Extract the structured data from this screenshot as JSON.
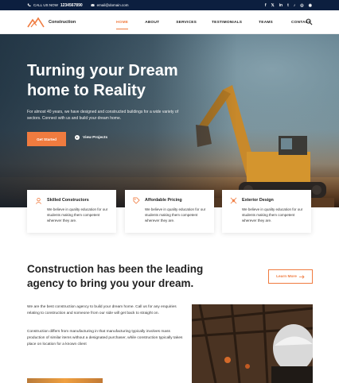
{
  "topbar": {
    "phone_label": "CALL US NOW",
    "phone_number": "1234567890",
    "email": "email@domain.com",
    "social": [
      "f",
      "𝕏",
      "in",
      "t",
      "♪",
      "◎",
      "◉"
    ]
  },
  "brand": {
    "name": "Construction"
  },
  "nav": {
    "items": [
      "HOME",
      "ABOUT",
      "SERVICES",
      "TESTIMONIALS",
      "TEAMS",
      "CONTACT"
    ],
    "active": "HOME"
  },
  "hero": {
    "title": "Turning your Dream home to Reality",
    "description": "For almost 40 years, we have designed and constructed buildings for a wide variety of sectors. Connect with us and build your dream home.",
    "primary_button": "Get Started",
    "video_button": "View Projects"
  },
  "features": [
    {
      "title": "Skilled Constructors",
      "text": "We believe in quality education for our students making them competent wherever they are.",
      "icon": "worker-icon"
    },
    {
      "title": "Affordable Pricing",
      "text": "We believe in quality education for our students making them competent wherever they are.",
      "icon": "price-tag-icon"
    },
    {
      "title": "Exterior Design",
      "text": "We believe in quality education for our students making them competent wherever they are.",
      "icon": "design-icon"
    }
  ],
  "about": {
    "title": "Construction has been the leading agency to bring you your dream.",
    "button": "Learn More",
    "p1": "We are the best construction agency to build your dream home. Call us for any enquiries relating to construction and someone from our side will get back to straight on.",
    "p2": "Construction differs from manufacturing in that manufacturing typically involves mass production of similar items without a designated purchaser, while construction typically takes place on location for a known client"
  },
  "colors": {
    "accent": "#f07b3f",
    "topbar": "#0c1f3f"
  }
}
